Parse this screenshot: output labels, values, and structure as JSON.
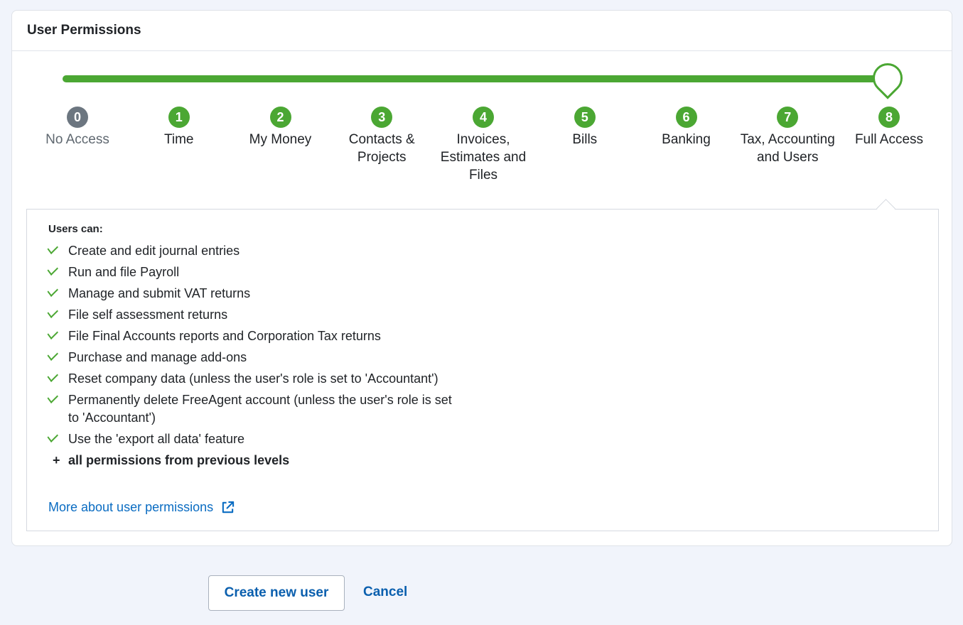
{
  "card": {
    "title": "User Permissions"
  },
  "slider": {
    "selected_level": 8,
    "max_level": 8,
    "levels": [
      {
        "number": "0",
        "label": "No Access"
      },
      {
        "number": "1",
        "label": "Time"
      },
      {
        "number": "2",
        "label": "My Money"
      },
      {
        "number": "3",
        "label": "Contacts & Projects"
      },
      {
        "number": "4",
        "label": "Invoices, Estimates and Files"
      },
      {
        "number": "5",
        "label": "Bills"
      },
      {
        "number": "6",
        "label": "Banking"
      },
      {
        "number": "7",
        "label": "Tax, Accounting and Users"
      },
      {
        "number": "8",
        "label": "Full Access"
      }
    ]
  },
  "panel": {
    "heading": "Users can:",
    "permissions": [
      "Create and edit journal entries",
      "Run and file Payroll",
      "Manage and submit VAT returns",
      "File self assessment returns",
      "File Final Accounts reports and Corporation Tax returns",
      "Purchase and manage add-ons",
      "Reset company data (unless the user's role is set to 'Accountant')",
      "Permanently delete FreeAgent account (unless the user's role is set to 'Accountant')",
      "Use the 'export all data' feature"
    ],
    "plus_text": "all permissions from previous levels",
    "plus_symbol": "+",
    "more_link": "More about user permissions"
  },
  "actions": {
    "create_label": "Create new user",
    "cancel_label": "Cancel"
  },
  "colors": {
    "accent_green": "#4ba733",
    "link_blue": "#0a6cc2",
    "grey_level": "#6c7680"
  }
}
